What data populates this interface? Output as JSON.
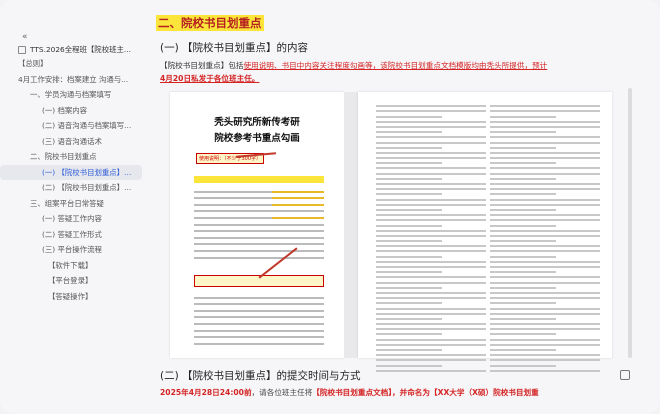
{
  "sidebar": {
    "doc_title": "TTS.2026全程班【院校班主...",
    "toc": [
      {
        "label": "【总则】",
        "indent": 0
      },
      {
        "label": "4月工作安排：档案建立 沟通与...",
        "indent": 0
      },
      {
        "label": "一、学员沟通与档案填写",
        "indent": 1
      },
      {
        "label": "(一) 档案内容",
        "indent": 2
      },
      {
        "label": "(二) 语音沟通与档案填写流程",
        "indent": 2
      },
      {
        "label": "(三) 语音沟通话术",
        "indent": 2
      },
      {
        "label": "二、院校书目划重点",
        "indent": 1
      },
      {
        "label": "(一) 【院校书目划重点】的...",
        "indent": 2
      },
      {
        "label": "(二) 【院校书目划重点】的...",
        "indent": 2
      },
      {
        "label": "三、组案平台日常答疑",
        "indent": 1
      },
      {
        "label": "(一) 答疑工作内容",
        "indent": 2
      },
      {
        "label": "(二) 答疑工作形式",
        "indent": 2
      },
      {
        "label": "(三) 平台操作流程",
        "indent": 2
      },
      {
        "label": "【软件下载】",
        "indent": 3
      },
      {
        "label": "【平台登录】",
        "indent": 3
      },
      {
        "label": "【答疑操作】",
        "indent": 3
      }
    ]
  },
  "main": {
    "heading": "二、院校书目划重点",
    "sub1": "(一) 【院校书目划重点】的内容",
    "para1_a": "【院校书目划重点】包括",
    "para1_b": "使用说明、书目中内容关注程度勾画等",
    "para1_c": "，该院校书目划重点文档模版均由秃头所提供，预计",
    "para1_d": "4月20日私发于各位班主任。",
    "doc_title1": "秃头研究所新传考研",
    "doc_title2": "院校参考书重点勾画",
    "usage_label": "使用说明：（不少于300字）",
    "sub2": "(二) 【院校书目划重点】的提交时间与方式",
    "para2_a": "2025年4月28日24:00前",
    "para2_b": "，请各位班主任将",
    "para2_c": "【院校书目划重点文档】，并命名为【XX大学（X硕）院校书目划重"
  }
}
